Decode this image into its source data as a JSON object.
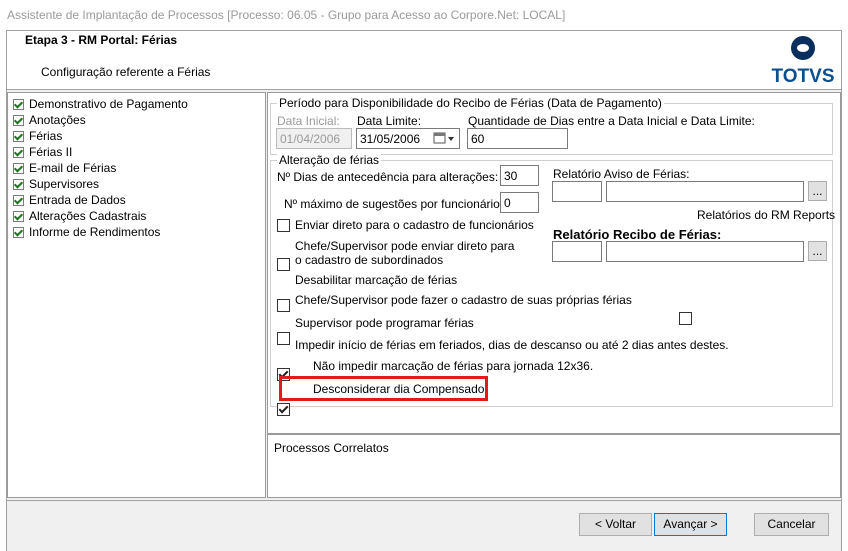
{
  "window": {
    "title": "Assistente de Implantação de Processos [Processo: 06.05 - Grupo para Acesso ao Corpore.Net: LOCAL]"
  },
  "header": {
    "title": "Etapa 3 - RM Portal: Férias",
    "subtitle": "Configuração referente a Férias",
    "logo_text": "TOTVS"
  },
  "tree": {
    "items": [
      {
        "label": "Demonstrativo de Pagamento"
      },
      {
        "label": "Anotações"
      },
      {
        "label": "Férias"
      },
      {
        "label": "Férias II"
      },
      {
        "label": "E-mail de Férias"
      },
      {
        "label": "Supervisores"
      },
      {
        "label": "Entrada de Dados"
      },
      {
        "label": "Alterações Cadastrais"
      },
      {
        "label": "Informe de Rendimentos"
      }
    ]
  },
  "periodo": {
    "group_label": "Período para Disponibilidade do Recibo de Férias (Data de Pagamento)",
    "data_inicial_label": "Data Inicial:",
    "data_inicial_value": "01/04/2006",
    "data_limite_label": "Data Limite:",
    "data_limite_value": "31/05/2006",
    "qtd_label": "Quantidade de Dias entre a Data Inicial e Data Limite:",
    "qtd_value": "60"
  },
  "alteracao": {
    "group_label": "Alteração de férias",
    "dias_antecedencia_label": "Nº Dias de antecedência para alterações:",
    "dias_antecedencia_value": "30",
    "max_sugestoes_label": "Nº máximo de sugestões por funcionário:",
    "max_sugestoes_value": "0",
    "options": [
      {
        "label": "Enviar direto para o cadastro de funcionários",
        "checked": false
      },
      {
        "label": "Chefe/Supervisor pode enviar direto para o cadastro de subordinados",
        "checked": false
      },
      {
        "label": "Desabilitar marcação de férias",
        "checked": false
      },
      {
        "label": "Chefe/Supervisor pode fazer o cadastro de suas próprias férias",
        "checked": false
      },
      {
        "label": "Supervisor pode programar férias",
        "checked": true
      },
      {
        "label": "Impedir início de férias em feriados, dias de descanso ou até 2 dias antes destes.",
        "checked": true
      },
      {
        "label": "Não impedir marcação de férias para jornada 12x36.",
        "checked": false
      },
      {
        "label": "Desconsiderar dia Compensado",
        "checked": true
      }
    ],
    "relatorio_aviso_label": "Relatório Aviso de Férias:",
    "relatorios_rm_reports_label": "Relatórios do RM Reports",
    "relatorio_recibo_label": "Relatório Recibo de Férias:",
    "browse_label": "..."
  },
  "correlatos": {
    "label": "Processos Correlatos"
  },
  "footer": {
    "back_label": "< Voltar",
    "next_label": "Avançar >",
    "cancel_label": "Cancelar"
  },
  "colors": {
    "highlight": "#e11b1b",
    "brand": "#0b2f5c"
  }
}
